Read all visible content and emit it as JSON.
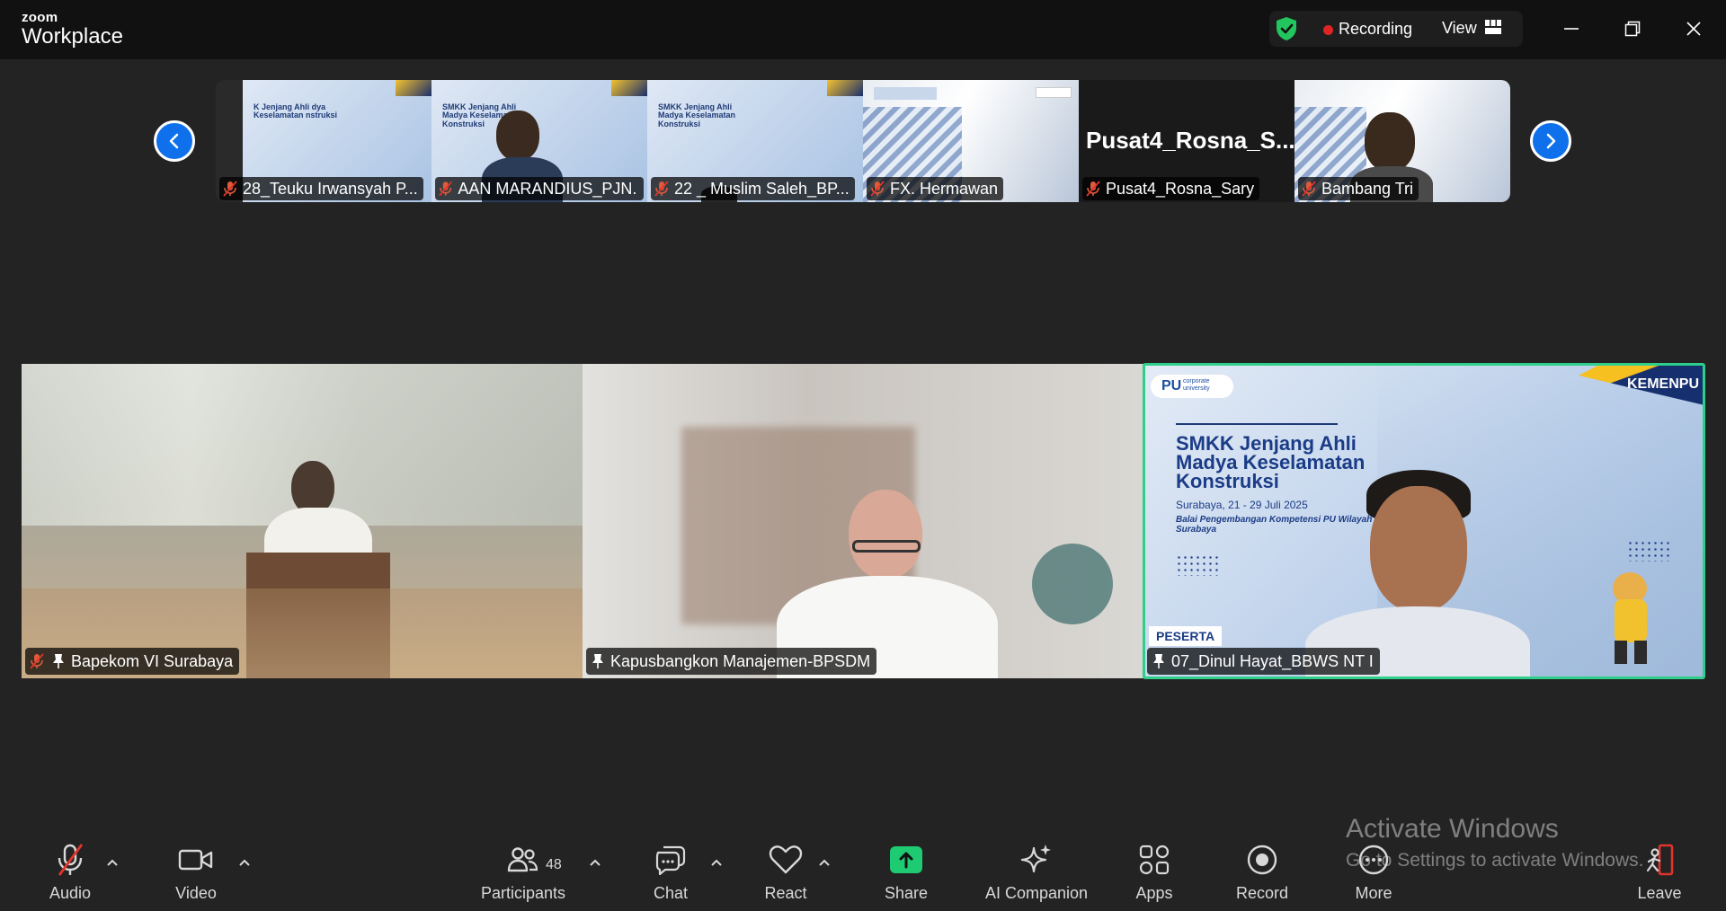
{
  "app": {
    "brand_top": "zoom",
    "brand_main": "Workplace"
  },
  "header": {
    "recording_label": "Recording",
    "view_label": "View"
  },
  "thumbnails": [
    {
      "name": "28_Teuku Irwansyah P...",
      "muted": true,
      "slide_text": "K Jenjang Ahli dya Keselamatan nstruksi"
    },
    {
      "name": "AAN MARANDIUS_PJN...",
      "muted": true,
      "slide_text": "SMKK Jenjang Ahli Madya Keselamatan Konstruksi"
    },
    {
      "name": "22 _ Muslim Saleh_BP...",
      "muted": true,
      "slide_text": "SMKK Jenjang Ahli Madya Keselamatan Konstruksi"
    },
    {
      "name": "FX. Hermawan",
      "muted": true
    },
    {
      "name": "Pusat4_Rosna_Sary",
      "muted": true,
      "big_name": "Pusat4_Rosna_S..."
    },
    {
      "name": "Bambang Tri",
      "muted": true
    }
  ],
  "tiles": [
    {
      "name": "Bapekom VI Surabaya",
      "muted": true,
      "pinned": true
    },
    {
      "name": "Kapusbangkon Manajemen-BPSDM",
      "muted": false,
      "pinned": true
    },
    {
      "name": "07_Dinul Hayat_BBWS NT I",
      "muted": false,
      "pinned": true,
      "active": true
    }
  ],
  "slide": {
    "pu_logo": "PU",
    "pu_sub": "corporate university",
    "kemenpu": "KEMENPU",
    "title": "SMKK Jenjang Ahli Madya Keselamatan Konstruksi",
    "date": "Surabaya, 21 - 29 Juli 2025",
    "org": "Balai Pengembangan Kompetensi PU Wilayah VI Surabaya",
    "badge": "PESERTA"
  },
  "toolbar": {
    "audio": "Audio",
    "video": "Video",
    "participants": "Participants",
    "participants_count": "48",
    "chat": "Chat",
    "react": "React",
    "share": "Share",
    "ai_companion": "AI Companion",
    "apps": "Apps",
    "record": "Record",
    "more": "More",
    "leave": "Leave"
  },
  "watermark": {
    "title": "Activate Windows",
    "subtitle": "Go to Settings to activate Windows."
  },
  "colors": {
    "accent": "#0e71eb",
    "active_speaker": "#2ecf8a",
    "recording": "#e02424",
    "share": "#1ecb73",
    "leave": "#e02424"
  }
}
